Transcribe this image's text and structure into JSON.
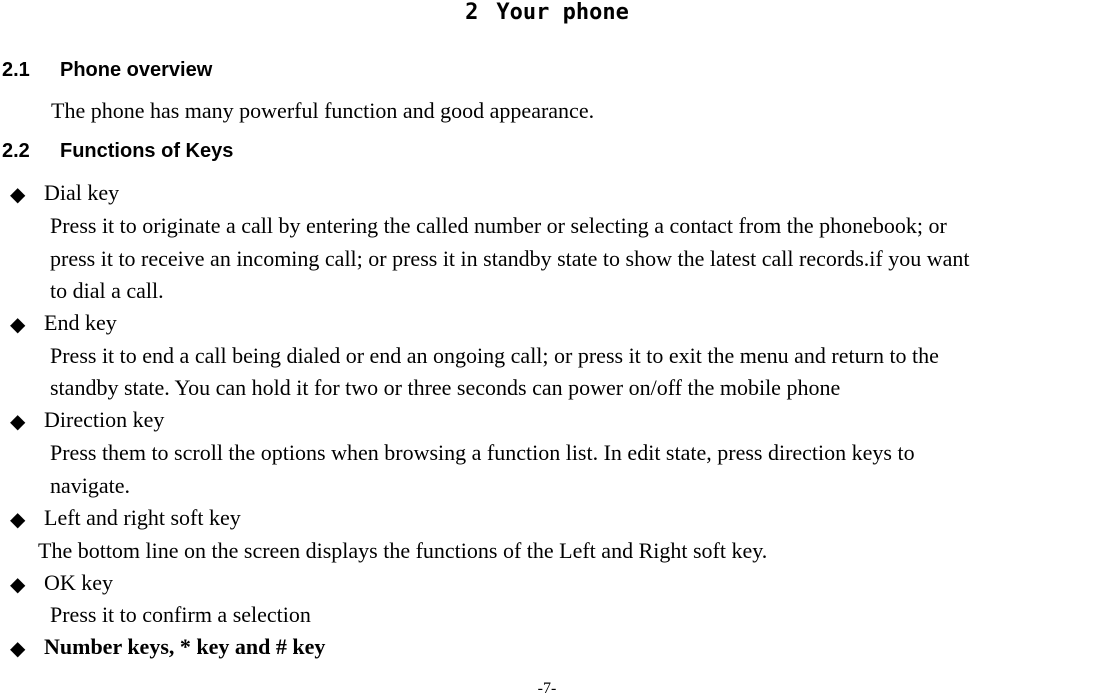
{
  "chapter": {
    "number": "2",
    "title": "Your phone"
  },
  "sections": [
    {
      "number": "2.1",
      "title": "Phone overview",
      "text": "The phone has many powerful function and good appearance."
    },
    {
      "number": "2.2",
      "title": "Functions of Keys"
    }
  ],
  "bullet_icon": "◆",
  "keys": [
    {
      "title": "Dial key",
      "lines": [
        "Press it to originate a call by entering the called number or selecting a contact from the phonebook; or",
        "press it to receive an incoming call; or press it in standby state to show the latest call records.if you want",
        "to dial a call."
      ]
    },
    {
      "title": "End key",
      "lines": [
        "Press it to end a call being dialed or end an ongoing call; or press it to exit the menu and return to the",
        "standby state. You can hold it for two or three seconds can power on/off the mobile phone"
      ]
    },
    {
      "title": "Direction key",
      "lines": [
        "Press them to scroll the options when browsing a function list. In edit state, press direction keys to",
        "navigate."
      ]
    },
    {
      "title": "Left and right soft key",
      "lines": [
        "The bottom line on the screen displays the functions of the Left and Right soft key."
      ]
    },
    {
      "title": "OK key",
      "lines": [
        "Press it to confirm a selection"
      ]
    },
    {
      "title": "Number keys, * key and # key",
      "lines": []
    }
  ],
  "footer": {
    "page_number": "-7-"
  }
}
